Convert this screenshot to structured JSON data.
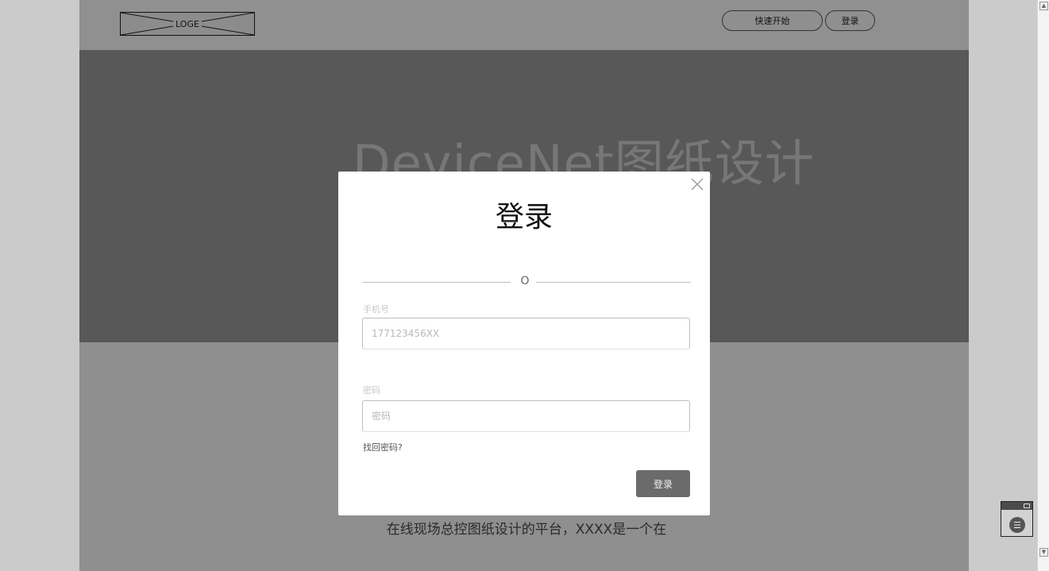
{
  "header": {
    "logo_text": "LOGE",
    "quick_start_label": "快速开始",
    "login_label": "登录"
  },
  "hero": {
    "title": "DeviceNet图纸设计"
  },
  "body_text": "XXXX是一个在线现场总控图纸设计的平台，XXXX是一个在线现场总控图纸设计的平台，XXXX是一个在",
  "modal": {
    "title": "登录",
    "divider_text": "O",
    "phone": {
      "label": "手机号",
      "placeholder": "177123456XX",
      "value": ""
    },
    "password": {
      "label": "密码",
      "placeholder": "密码",
      "value": ""
    },
    "forgot_label": "找回密码?",
    "submit_label": "登录"
  },
  "colors": {
    "overlay_page": "#8f8f8f",
    "hero_bg": "#585858",
    "modal_bg": "#ffffff",
    "submit_bg": "#6b6b6b"
  },
  "icons": {
    "close": "close-icon",
    "float_menu": "menu-icon",
    "scroll_up": "arrow-up-icon",
    "scroll_down": "arrow-down-icon"
  }
}
